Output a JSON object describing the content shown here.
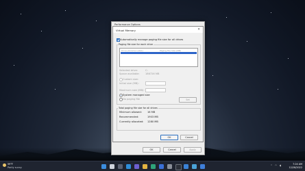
{
  "perf_window": {
    "title": "Performance Options",
    "buttons": {
      "ok": "OK",
      "cancel": "Cancel",
      "apply": "Apply"
    }
  },
  "dialog": {
    "title": "Virtual Memory",
    "auto_manage_label": "Automatically manage paging file size for all drives",
    "auto_manage_checked": true,
    "group_drive_label": "Paging file size for each drive",
    "list_headers": {
      "drive": "Drive [Volume Label]",
      "size": "Paging File Size (MB)"
    },
    "selected_drive_label": "Selected drive:",
    "selected_drive_value": "C:",
    "space_available_label": "Space available:",
    "space_available_value": "186726 MB",
    "custom_size_label": "Custom size:",
    "initial_size_label": "Initial size (MB):",
    "maximum_size_label": "Maximum size (MB):",
    "system_managed_label": "System managed size",
    "no_paging_label": "No paging file",
    "set_button": "Set",
    "total_group_label": "Total paging file size for all drives",
    "min_allowed_label": "Minimum allowed:",
    "min_allowed_value": "16 MB",
    "recommended_label": "Recommended:",
    "recommended_value": "1903 MB",
    "currently_allocated_label": "Currently allocated:",
    "currently_allocated_value": "1280 MB",
    "ok": "OK",
    "cancel": "Cancel"
  },
  "taskbar": {
    "weather_temp": "59°F",
    "weather_desc": "Partly sunny",
    "time": "7:24 AM",
    "date": "12/28/2022",
    "icons": [
      "start-icon",
      "search-icon",
      "task-view-icon",
      "widgets-icon",
      "chat-icon",
      "file-explorer-icon",
      "edge-icon",
      "store-icon",
      "settings-icon",
      "terminal-icon",
      "mail-icon",
      "photos-icon",
      "security-icon"
    ]
  },
  "colors": {
    "accent": "#2d64c8",
    "taskbar": "#1f2430"
  }
}
